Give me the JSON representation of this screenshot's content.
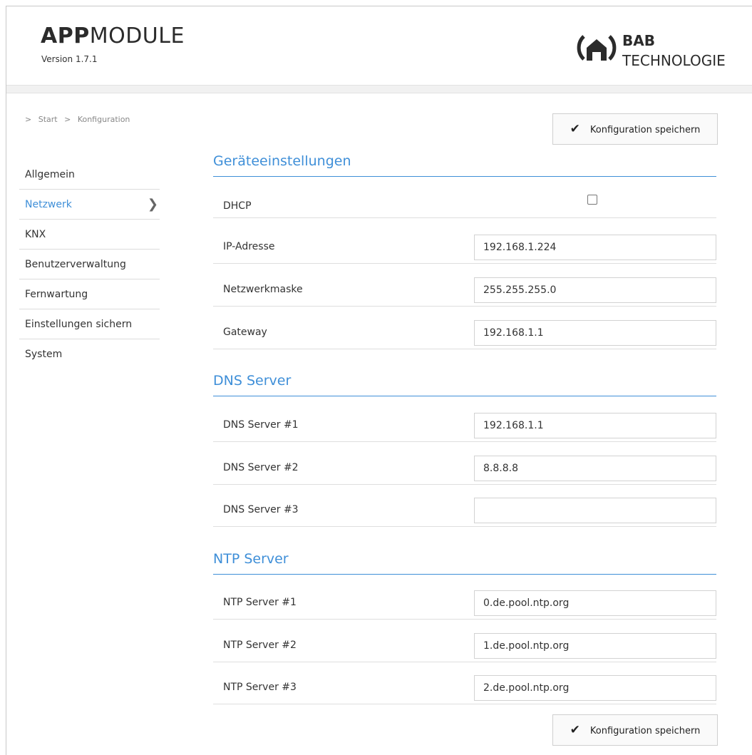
{
  "header": {
    "brand_bold": "APP",
    "brand_rest": "MODULE",
    "version": "Version 1.7.1",
    "logo_line1": "BAB",
    "logo_line2": "TECHNOLOGIE"
  },
  "breadcrumb": [
    ">",
    "Start",
    ">",
    "Konfiguration"
  ],
  "sidebar": {
    "items": [
      {
        "label": "Allgemein"
      },
      {
        "label": "Netzwerk"
      },
      {
        "label": "KNX"
      },
      {
        "label": "Benutzerverwaltung"
      },
      {
        "label": "Fernwartung"
      },
      {
        "label": "Einstellungen sichern"
      },
      {
        "label": "System"
      }
    ],
    "active_item": "Netzwerk"
  },
  "save_button": {
    "label": "Konfiguration speichern",
    "icon": "checkmark-icon"
  },
  "sections": {
    "device": {
      "title": "Geräteeinstellungen",
      "dhcp_label": "DHCP",
      "dhcp_checked": false,
      "ip_label": "IP-Adresse",
      "ip_value": "192.168.1.224",
      "mask_label": "Netzwerkmaske",
      "mask_value": "255.255.255.0",
      "gateway_label": "Gateway",
      "gateway_value": "192.168.1.1"
    },
    "dns": {
      "title": "DNS Server",
      "dns1_label": "DNS Server #1",
      "dns1_value": "192.168.1.1",
      "dns2_label": "DNS Server #2",
      "dns2_value": "8.8.8.8",
      "dns3_label": "DNS Server #3",
      "dns3_value": ""
    },
    "ntp": {
      "title": "NTP Server",
      "ntp1_label": "NTP Server #1",
      "ntp1_value": "0.de.pool.ntp.org",
      "ntp2_label": "NTP Server #2",
      "ntp2_value": "1.de.pool.ntp.org",
      "ntp3_label": "NTP Server #3",
      "ntp3_value": "2.de.pool.ntp.org"
    }
  },
  "colors": {
    "accent": "#3f8fd8",
    "border": "#dcdcdc"
  }
}
